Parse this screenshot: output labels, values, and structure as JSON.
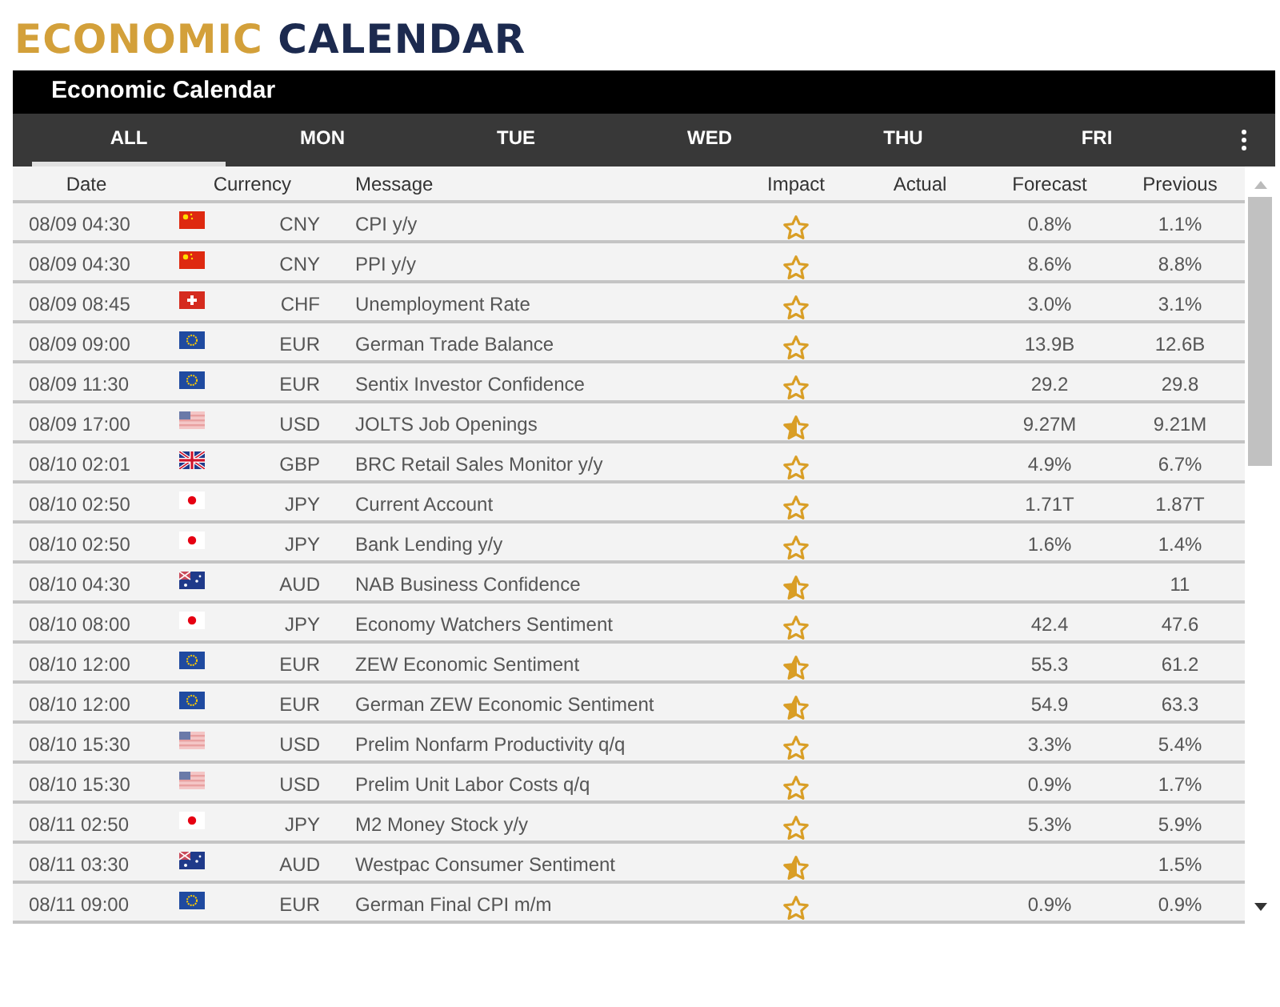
{
  "page_heading": {
    "first": "ECONOMIC",
    "second": "CALENDAR"
  },
  "widget": {
    "title": "Economic Calendar",
    "tabs": [
      {
        "label": "ALL",
        "selected": true
      },
      {
        "label": "MON",
        "selected": false
      },
      {
        "label": "TUE",
        "selected": false
      },
      {
        "label": "WED",
        "selected": false
      },
      {
        "label": "THU",
        "selected": false
      },
      {
        "label": "FRI",
        "selected": false
      }
    ],
    "columns": [
      "Date",
      "Currency",
      "Message",
      "Impact",
      "Actual",
      "Forecast",
      "Previous"
    ],
    "rows": [
      {
        "date": "08/09 04:30",
        "kind": "cn",
        "currency": "CNY",
        "message": "CPI y/y",
        "impact": {
          "half_filled": false
        },
        "forecast": "0.8%",
        "previous": "1.1%"
      },
      {
        "date": "08/09 04:30",
        "kind": "cn",
        "currency": "CNY",
        "message": "PPI y/y",
        "impact": {
          "half_filled": false
        },
        "forecast": "8.6%",
        "previous": "8.8%"
      },
      {
        "date": "08/09 08:45",
        "kind": "ch",
        "currency": "CHF",
        "message": "Unemployment Rate",
        "impact": {
          "half_filled": false
        },
        "forecast": "3.0%",
        "previous": "3.1%"
      },
      {
        "date": "08/09 09:00",
        "kind": "eu",
        "currency": "EUR",
        "message": "German Trade Balance",
        "impact": {
          "half_filled": false
        },
        "forecast": "13.9B",
        "previous": "12.6B"
      },
      {
        "date": "08/09 11:30",
        "kind": "eu",
        "currency": "EUR",
        "message": "Sentix Investor Confidence",
        "impact": {
          "half_filled": false
        },
        "forecast": "29.2",
        "previous": "29.8"
      },
      {
        "date": "08/09 17:00",
        "kind": "us",
        "currency": "USD",
        "message": "JOLTS Job Openings",
        "impact": {
          "half_filled": true
        },
        "forecast": "9.27M",
        "previous": "9.21M"
      },
      {
        "date": "08/10 02:01",
        "kind": "gb",
        "currency": "GBP",
        "message": "BRC Retail Sales Monitor y/y",
        "impact": {
          "half_filled": false
        },
        "forecast": "4.9%",
        "previous": "6.7%"
      },
      {
        "date": "08/10 02:50",
        "kind": "jp",
        "currency": "JPY",
        "message": "Current Account",
        "impact": {
          "half_filled": false
        },
        "forecast": "1.71T",
        "previous": "1.87T"
      },
      {
        "date": "08/10 02:50",
        "kind": "jp",
        "currency": "JPY",
        "message": "Bank Lending y/y",
        "impact": {
          "half_filled": false
        },
        "forecast": "1.6%",
        "previous": "1.4%"
      },
      {
        "date": "08/10 04:30",
        "kind": "au",
        "currency": "AUD",
        "message": "NAB Business Confidence",
        "impact": {
          "half_filled": true
        },
        "previous": "11"
      },
      {
        "date": "08/10 08:00",
        "kind": "jp",
        "currency": "JPY",
        "message": "Economy Watchers Sentiment",
        "impact": {
          "half_filled": false
        },
        "forecast": "42.4",
        "previous": "47.6"
      },
      {
        "date": "08/10 12:00",
        "kind": "eu",
        "currency": "EUR",
        "message": "ZEW Economic Sentiment",
        "impact": {
          "half_filled": true
        },
        "forecast": "55.3",
        "previous": "61.2"
      },
      {
        "date": "08/10 12:00",
        "kind": "eu",
        "currency": "EUR",
        "message": "German ZEW Economic Sentiment",
        "impact": {
          "half_filled": true
        },
        "forecast": "54.9",
        "previous": "63.3"
      },
      {
        "date": "08/10 15:30",
        "kind": "us",
        "currency": "USD",
        "message": "Prelim Nonfarm Productivity q/q",
        "impact": {
          "half_filled": false
        },
        "forecast": "3.3%",
        "previous": "5.4%"
      },
      {
        "date": "08/10 15:30",
        "kind": "us",
        "currency": "USD",
        "message": "Prelim Unit Labor Costs q/q",
        "impact": {
          "half_filled": false
        },
        "forecast": "0.9%",
        "previous": "1.7%"
      },
      {
        "date": "08/11 02:50",
        "kind": "jp",
        "currency": "JPY",
        "message": "M2 Money Stock y/y",
        "impact": {
          "half_filled": false
        },
        "forecast": "5.3%",
        "previous": "5.9%"
      },
      {
        "date": "08/11 03:30",
        "kind": "au",
        "currency": "AUD",
        "message": "Westpac Consumer Sentiment",
        "impact": {
          "half_filled": true
        },
        "previous": "1.5%"
      },
      {
        "date": "08/11 09:00",
        "kind": "eu",
        "currency": "EUR",
        "message": "German Final CPI m/m",
        "impact": {
          "half_filled": false
        },
        "forecast": "0.9%",
        "previous": "0.9%"
      }
    ]
  }
}
